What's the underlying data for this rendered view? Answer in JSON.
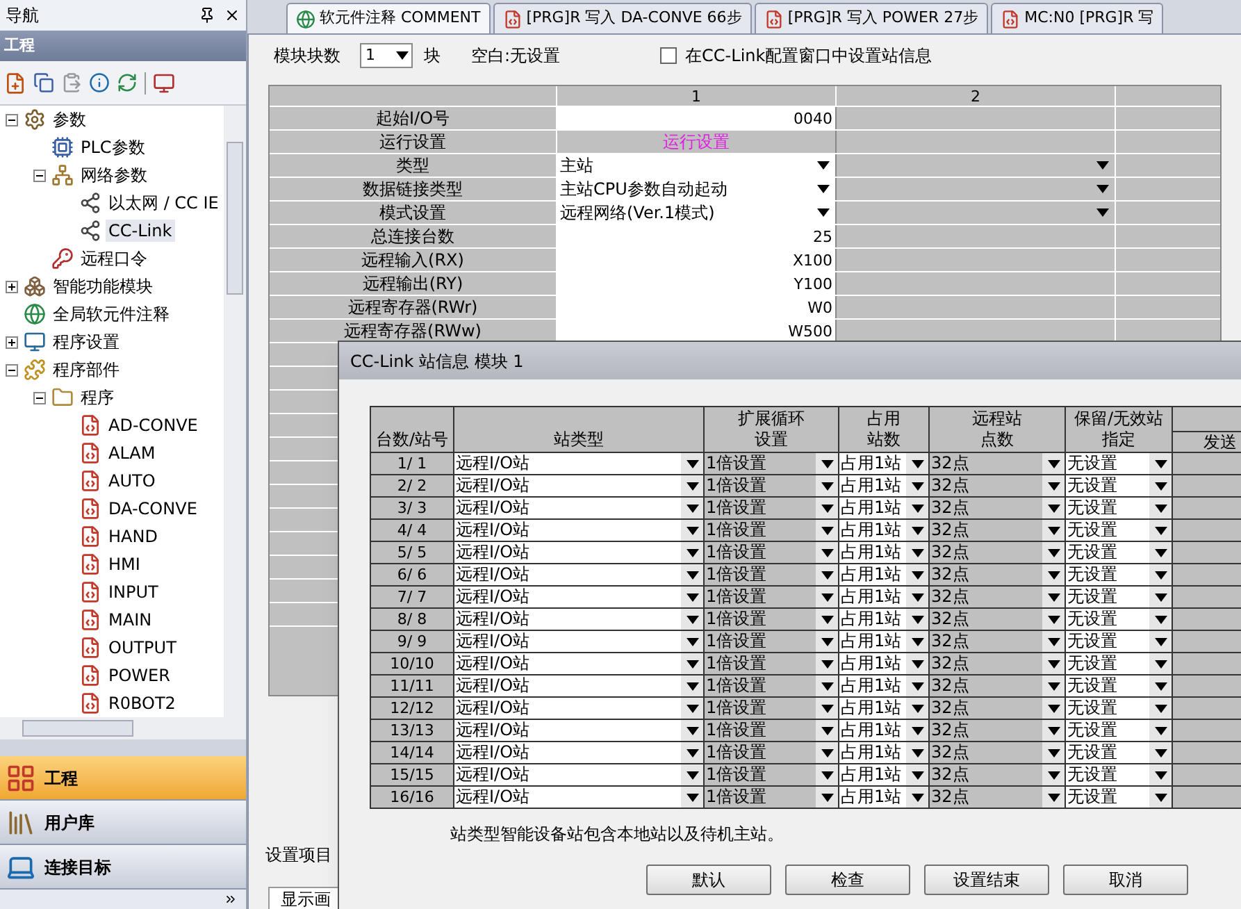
{
  "sidebar": {
    "title": "导航",
    "section": "工程",
    "tree": [
      {
        "label": "参数",
        "kind": "params",
        "selected": false,
        "expanded": true,
        "children": [
          {
            "label": "PLC参数",
            "kind": "plc",
            "selected": false
          },
          {
            "label": "网络参数",
            "kind": "network",
            "selected": false,
            "expanded": true,
            "children": [
              {
                "label": "以太网 / CC IE",
                "kind": "node",
                "selected": false
              },
              {
                "label": "CC-Link",
                "kind": "node",
                "selected": true
              }
            ]
          },
          {
            "label": "远程口令",
            "kind": "remote",
            "selected": false
          }
        ]
      },
      {
        "label": "智能功能模块",
        "kind": "module",
        "selected": false,
        "expanded": false
      },
      {
        "label": "全局软元件注释",
        "kind": "comment",
        "selected": false
      },
      {
        "label": "程序设置",
        "kind": "settings",
        "selected": false,
        "expanded": false
      },
      {
        "label": "程序部件",
        "kind": "parts",
        "selected": false,
        "expanded": true,
        "children": [
          {
            "label": "程序",
            "kind": "folder",
            "selected": false,
            "expanded": true,
            "children": [
              {
                "label": "AD-CONVE",
                "kind": "program",
                "selected": false
              },
              {
                "label": "ALAM",
                "kind": "program",
                "selected": false
              },
              {
                "label": "AUTO",
                "kind": "program",
                "selected": false
              },
              {
                "label": "DA-CONVE",
                "kind": "program",
                "selected": false
              },
              {
                "label": "HAND",
                "kind": "program",
                "selected": false
              },
              {
                "label": "HMI",
                "kind": "program",
                "selected": false
              },
              {
                "label": "INPUT",
                "kind": "program",
                "selected": false
              },
              {
                "label": "MAIN",
                "kind": "program",
                "selected": false
              },
              {
                "label": "OUTPUT",
                "kind": "program",
                "selected": false
              },
              {
                "label": "POWER",
                "kind": "program",
                "selected": false
              },
              {
                "label": "R0BOT2",
                "kind": "program",
                "selected": false
              }
            ]
          }
        ]
      }
    ],
    "nav_buttons": [
      {
        "label": "工程",
        "kind": "project",
        "selected": true
      },
      {
        "label": "用户库",
        "kind": "library",
        "selected": false
      },
      {
        "label": "连接目标",
        "kind": "target",
        "selected": false
      }
    ]
  },
  "tabs": [
    {
      "label": "软元件注释 COMMENT",
      "kind": "comment",
      "selected": true
    },
    {
      "label": "[PRG]R 写入 DA-CONVE 66步",
      "kind": "program",
      "selected": false
    },
    {
      "label": "[PRG]R 写入 POWER 27步",
      "kind": "program",
      "selected": false
    },
    {
      "label": "MC:N0 [PRG]R 写",
      "kind": "program",
      "selected": false
    }
  ],
  "module_count": {
    "label": "模块块数",
    "value": "1",
    "unit": "块"
  },
  "blank_note": "空白:无设置",
  "station_checkbox": {
    "label": "在CC-Link配置窗口中设置站信息",
    "checked": false
  },
  "param_table": {
    "columns": [
      "1",
      "2"
    ],
    "rows": [
      {
        "label": "起始I/O号",
        "kind": "text",
        "value": "0040"
      },
      {
        "label": "运行设置",
        "kind": "button",
        "value": "运行设置"
      },
      {
        "label": "类型",
        "kind": "select",
        "value": "主站"
      },
      {
        "label": "数据链接类型",
        "kind": "select",
        "value": "主站CPU参数自动起动"
      },
      {
        "label": "模式设置",
        "kind": "select",
        "value": "远程网络(Ver.1模式)"
      },
      {
        "label": "总连接台数",
        "kind": "text",
        "value": "25"
      },
      {
        "label": "远程输入(RX)",
        "kind": "text",
        "value": "X100"
      },
      {
        "label": "远程输出(RY)",
        "kind": "text",
        "value": "Y100"
      },
      {
        "label": "远程寄存器(RWr)",
        "kind": "text",
        "value": "W0"
      },
      {
        "label": "远程寄存器(RWw)",
        "kind": "text",
        "value": "W500"
      }
    ]
  },
  "settings_note": "设置项目",
  "bottom_tab": "显示画",
  "dialog": {
    "title": "CC-Link 站信息 模块 1",
    "columns": [
      {
        "lines": [
          "台数/站号"
        ],
        "kind": "station",
        "disabled": true
      },
      {
        "lines": [
          "站类型"
        ],
        "kind": "select",
        "disabled": false
      },
      {
        "lines": [
          "扩展循环",
          "设置"
        ],
        "kind": "select",
        "disabled": true
      },
      {
        "lines": [
          "占用",
          "站数"
        ],
        "kind": "select",
        "disabled": false
      },
      {
        "lines": [
          "远程站",
          "点数"
        ],
        "kind": "select",
        "disabled": true
      },
      {
        "lines": [
          "保留/无效站",
          "指定"
        ],
        "kind": "select",
        "disabled": false
      }
    ],
    "cut_column": {
      "label": "发送"
    },
    "rows": [
      [
        "1/ 1",
        "远程I/O站",
        "1倍设置",
        "占用1站",
        "32点",
        "无设置"
      ],
      [
        "2/ 2",
        "远程I/O站",
        "1倍设置",
        "占用1站",
        "32点",
        "无设置"
      ],
      [
        "3/ 3",
        "远程I/O站",
        "1倍设置",
        "占用1站",
        "32点",
        "无设置"
      ],
      [
        "4/ 4",
        "远程I/O站",
        "1倍设置",
        "占用1站",
        "32点",
        "无设置"
      ],
      [
        "5/ 5",
        "远程I/O站",
        "1倍设置",
        "占用1站",
        "32点",
        "无设置"
      ],
      [
        "6/ 6",
        "远程I/O站",
        "1倍设置",
        "占用1站",
        "32点",
        "无设置"
      ],
      [
        "7/ 7",
        "远程I/O站",
        "1倍设置",
        "占用1站",
        "32点",
        "无设置"
      ],
      [
        "8/ 8",
        "远程I/O站",
        "1倍设置",
        "占用1站",
        "32点",
        "无设置"
      ],
      [
        "9/ 9",
        "远程I/O站",
        "1倍设置",
        "占用1站",
        "32点",
        "无设置"
      ],
      [
        "10/10",
        "远程I/O站",
        "1倍设置",
        "占用1站",
        "32点",
        "无设置"
      ],
      [
        "11/11",
        "远程I/O站",
        "1倍设置",
        "占用1站",
        "32点",
        "无设置"
      ],
      [
        "12/12",
        "远程I/O站",
        "1倍设置",
        "占用1站",
        "32点",
        "无设置"
      ],
      [
        "13/13",
        "远程I/O站",
        "1倍设置",
        "占用1站",
        "32点",
        "无设置"
      ],
      [
        "14/14",
        "远程I/O站",
        "1倍设置",
        "占用1站",
        "32点",
        "无设置"
      ],
      [
        "15/15",
        "远程I/O站",
        "1倍设置",
        "占用1站",
        "32点",
        "无设置"
      ],
      [
        "16/16",
        "远程I/O站",
        "1倍设置",
        "占用1站",
        "32点",
        "无设置"
      ]
    ],
    "note": "站类型智能设备站包含本地站以及待机主站。",
    "buttons": [
      "默认",
      "检查",
      "设置结束",
      "取消"
    ]
  }
}
